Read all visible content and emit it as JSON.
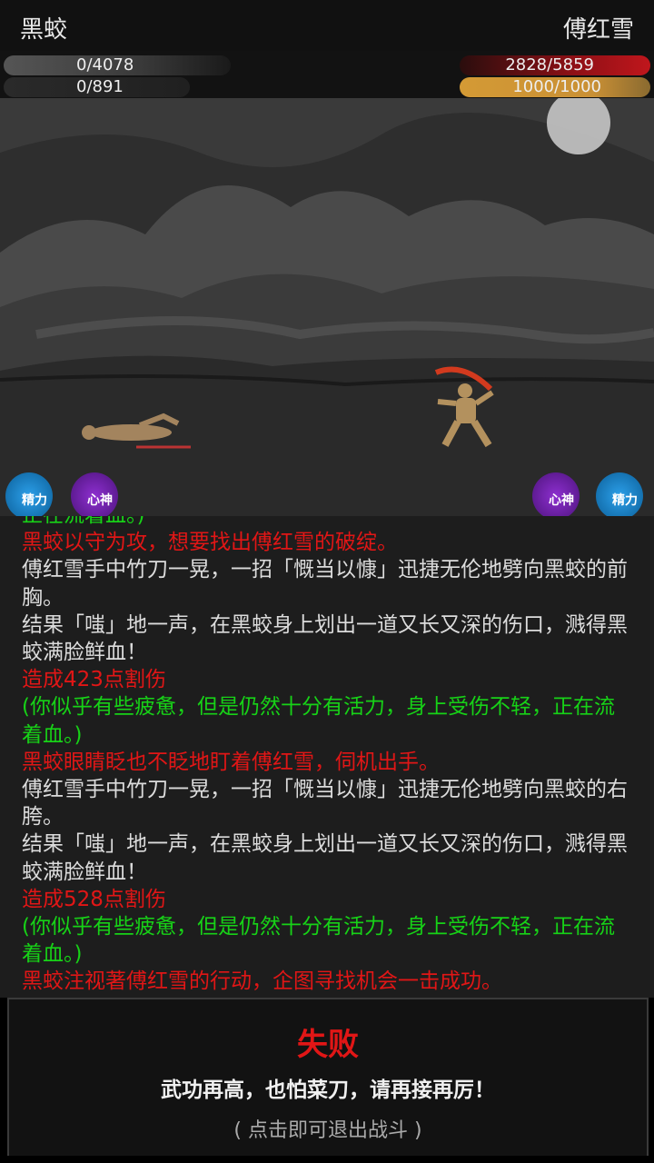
{
  "header": {
    "enemy_name": "黑蛟",
    "player_name": "傅红雪"
  },
  "enemy": {
    "hp_text": "0/4078",
    "mp_text": "0/891",
    "hp_fraction": 0,
    "mp_fraction": 0
  },
  "player": {
    "hp_text": "2828/5859",
    "mp_text": "1000/1000",
    "hp_fraction": 0.483,
    "mp_fraction": 1.0,
    "hp_color": "#b8141a",
    "mp_color": "#d4a23e"
  },
  "status": {
    "stamina_label": "精力",
    "spirit_label": "心神",
    "stamina_color": "#1d8fd8",
    "spirit_color": "#7a22b8"
  },
  "log": [
    {
      "text": "正在流着血。)",
      "color": "green"
    },
    {
      "text": "黑蛟以守为攻，想要找出傅红雪的破绽。",
      "color": "red"
    },
    {
      "text": "傅红雪手中竹刀一晃，一招「慨当以慷」迅捷无伦地劈向黑蛟的前胸。",
      "color": "white"
    },
    {
      "text": "结果「嗤」地一声，在黑蛟身上划出一道又长又深的伤口，溅得黑蛟满脸鲜血！",
      "color": "white"
    },
    {
      "text": "造成423点割伤",
      "color": "red"
    },
    {
      "text": "(你似乎有些疲惫，但是仍然十分有活力，身上受伤不轻，正在流着血。)",
      "color": "green"
    },
    {
      "text": "黑蛟眼睛眨也不眨地盯着傅红雪，伺机出手。",
      "color": "red"
    },
    {
      "text": "傅红雪手中竹刀一晃，一招「慨当以慷」迅捷无伦地劈向黑蛟的右胯。",
      "color": "white"
    },
    {
      "text": "结果「嗤」地一声，在黑蛟身上划出一道又长又深的伤口，溅得黑蛟满脸鲜血！",
      "color": "white"
    },
    {
      "text": "造成528点割伤",
      "color": "red"
    },
    {
      "text": "(你似乎有些疲惫，但是仍然十分有活力，身上受伤不轻，正在流着血。)",
      "color": "green"
    },
    {
      "text": "黑蛟注视著傅红雪的行动，企图寻找机会一击成功。",
      "color": "red"
    }
  ],
  "result": {
    "title": "失败",
    "message": "武功再高，也怕菜刀，请再接再厉！",
    "hint": "( 点击即可退出战斗 )"
  }
}
